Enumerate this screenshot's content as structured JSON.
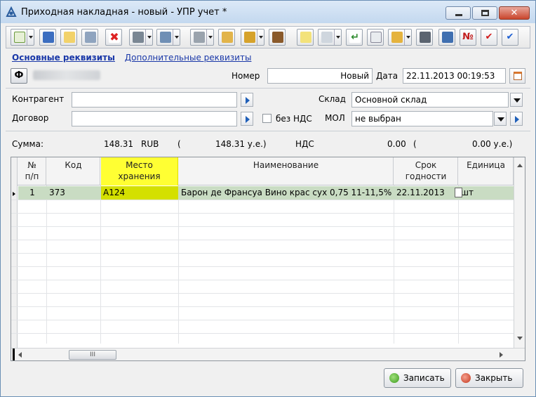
{
  "window": {
    "title": "Приходная накладная - новый - УПР учет *"
  },
  "tabs": {
    "main": "Основные реквизиты",
    "additional": "Дополнительные реквизиты"
  },
  "header": {
    "org_button": "Ф",
    "number_label": "Номер",
    "number_value": "Новый",
    "date_label": "Дата",
    "date_value": "22.11.2013 00:19:53"
  },
  "form": {
    "counterparty_label": "Контрагент",
    "counterparty_value": "",
    "contract_label": "Договор",
    "contract_value": "",
    "no_vat_label": "без НДС",
    "no_vat_checked": false,
    "warehouse_label": "Склад",
    "warehouse_value": "Основной склад",
    "mol_label": "МОЛ",
    "mol_value": "не выбран"
  },
  "totals": {
    "sum_label": "Сумма:",
    "sum_value": "148.31",
    "currency": "RUB",
    "open_paren": "(",
    "ue_value": "148.31 у.е.)",
    "vat_label": "НДС",
    "vat_value": "0.00",
    "vat_paren": "(",
    "vat_ue_value": "0.00 у.е.)"
  },
  "grid": {
    "columns": [
      {
        "line1": "№",
        "line2": "п/п"
      },
      {
        "line1": "Код",
        "line2": ""
      },
      {
        "line1": "Место",
        "line2": "хранения"
      },
      {
        "line1": "Наименование",
        "line2": ""
      },
      {
        "line1": "Срок",
        "line2": "годности"
      },
      {
        "line1": "Единица",
        "line2": ""
      }
    ],
    "rows": [
      {
        "num": "1",
        "code": "373",
        "location": "А124",
        "name": "Барон де Франсуа Вино крас сух 0,75 11-11,5%",
        "expiry": "22.11.2013",
        "unit": "шт"
      }
    ],
    "hscroll_thumb": "III"
  },
  "buttons": {
    "save": "Записать",
    "close": "Закрыть"
  },
  "toolbar": {
    "number_icon": "№",
    "check_icon": "✔",
    "icons": [
      "new-document-icon",
      "list-icon",
      "edit-icon",
      "print-preview-icon",
      "delete-icon",
      "form-icon",
      "report-icon",
      "printer-icon",
      "export-icon",
      "coins-icon",
      "book-icon",
      "add-icon",
      "table-icon",
      "enter-icon",
      "doc-search-icon",
      "folder-icon",
      "calculator-icon",
      "monitor-icon",
      "number-icon",
      "check-red-icon",
      "check-blue-icon"
    ]
  },
  "colors": {
    "highlight_column": "#ffff33",
    "selected_row": "#c9dcc3",
    "link": "#1a38a8"
  }
}
